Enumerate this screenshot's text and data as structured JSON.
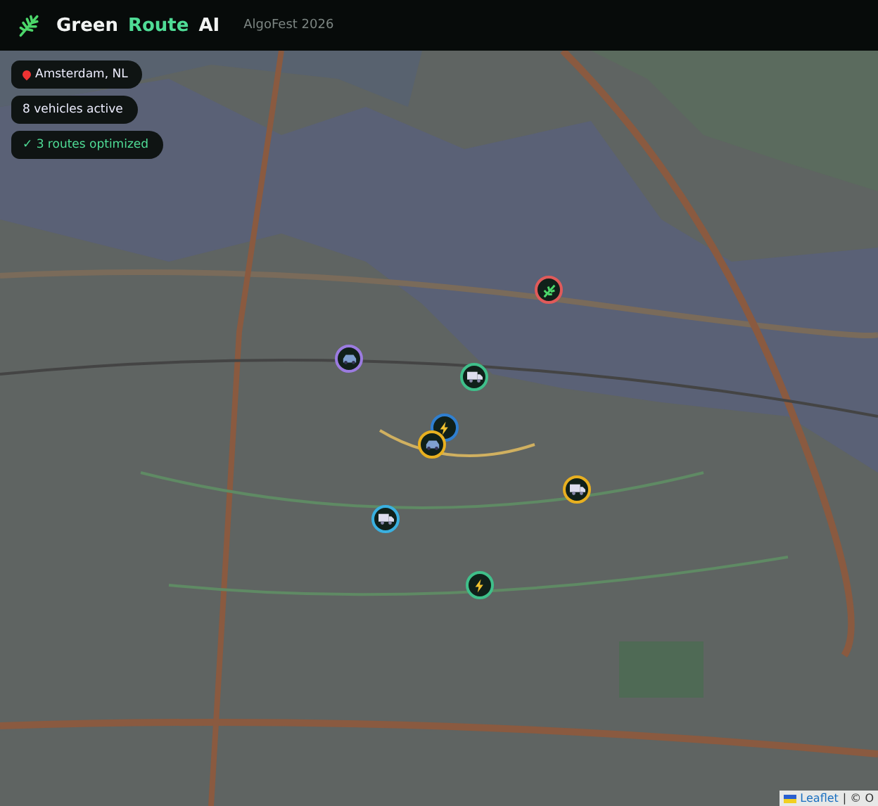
{
  "header": {
    "brand": [
      {
        "text": "Green",
        "kind": "plain"
      },
      {
        "text": "Route",
        "kind": "accent"
      },
      {
        "text": "AI",
        "kind": "plain"
      }
    ],
    "event": "AlgoFest 2026"
  },
  "overlay": {
    "location": "Amsterdam, NL",
    "vehicles": "8 vehicles active",
    "routes": "✓ 3 routes optimized"
  },
  "markers": [
    {
      "kind": "leaf",
      "color": "#e05a5a"
    },
    {
      "kind": "car",
      "color": "#9b7be0"
    },
    {
      "kind": "van",
      "color": "#3fbf8a"
    },
    {
      "kind": "bolt",
      "color": "#2f7fd0"
    },
    {
      "kind": "car",
      "color": "#e8b020"
    },
    {
      "kind": "van",
      "color": "#e8b020"
    },
    {
      "kind": "van",
      "color": "#3ab0e0"
    },
    {
      "kind": "bolt",
      "color": "#3fbf8a"
    }
  ],
  "attribution": {
    "link": "Leaflet",
    "rest": "| © O"
  }
}
